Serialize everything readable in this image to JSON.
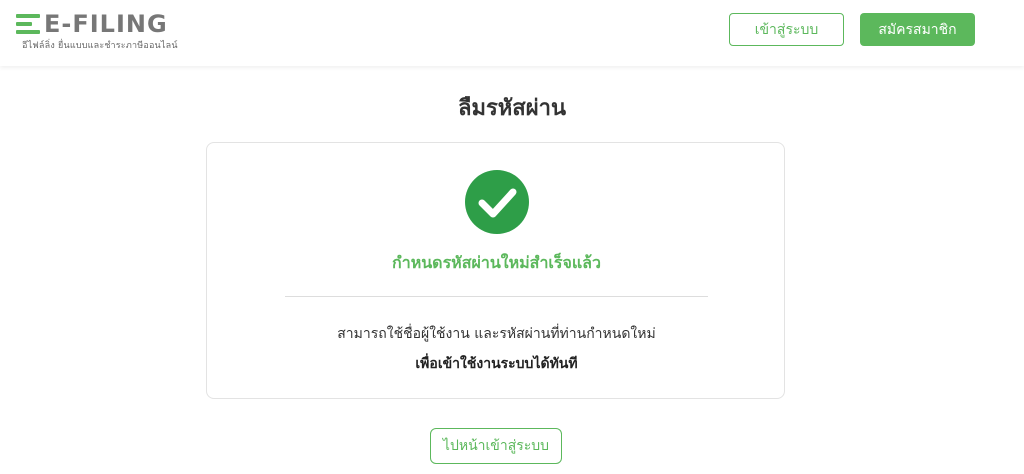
{
  "header": {
    "logo_text": "E-FILING",
    "logo_tagline": "อีไฟล์ลิ่ง ยื่นแบบและชำระภาษีออนไลน์",
    "login_label": "เข้าสู่ระบบ",
    "register_label": "สมัครสมาชิก"
  },
  "main": {
    "title": "ลืมรหัสผ่าน",
    "success_message": "กำหนดรหัสผ่านใหม่สำเร็จแล้ว",
    "info_line1": "สามารถใช้ชื่อผู้ใช้งาน และรหัสผ่านที่ท่านกำหนดใหม่",
    "info_line2": "เพื่อเข้าใช้งานระบบได้ทันที",
    "goto_login_label": "ไปหน้าเข้าสู่ระบบ"
  },
  "icons": {
    "logo": "efiling-logo-icon",
    "success": "check-circle-icon"
  },
  "colors": {
    "accent": "#5cb85c",
    "success_circle": "#2e9e48"
  }
}
